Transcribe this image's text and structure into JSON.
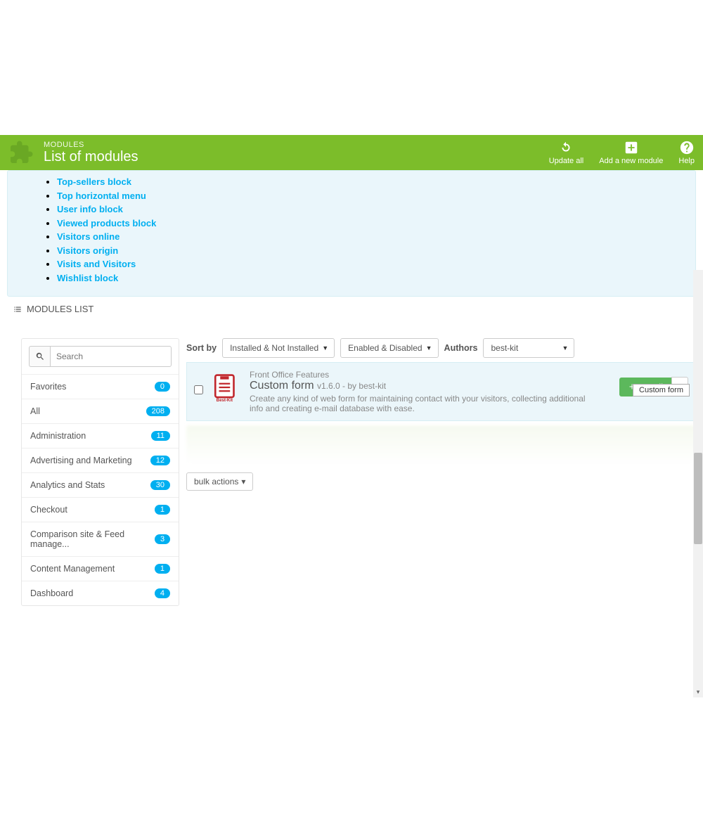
{
  "header": {
    "crumb": "MODULES",
    "title": "List of modules",
    "update": "Update all",
    "add": "Add a new module",
    "help": "Help"
  },
  "linklist": [
    "Top-sellers block",
    "Top horizontal menu",
    "User info block",
    "Viewed products block",
    "Visitors online",
    "Visitors origin",
    "Visits and Visitors",
    "Wishlist block"
  ],
  "section_title": "MODULES LIST",
  "search": {
    "placeholder": "Search"
  },
  "categories": [
    {
      "label": "Favorites",
      "count": "0"
    },
    {
      "label": "All",
      "count": "208"
    },
    {
      "label": "Administration",
      "count": "11"
    },
    {
      "label": "Advertising and Marketing",
      "count": "12"
    },
    {
      "label": "Analytics and Stats",
      "count": "30"
    },
    {
      "label": "Checkout",
      "count": "1"
    },
    {
      "label": "Comparison site & Feed manage...",
      "count": "3"
    },
    {
      "label": "Content Management",
      "count": "1"
    },
    {
      "label": "Dashboard",
      "count": "4"
    }
  ],
  "sort": {
    "label": "Sort by",
    "sel1": "Installed & Not Installed",
    "sel2": "Enabled & Disabled",
    "authors_label": "Authors",
    "sel3": "best-kit"
  },
  "module": {
    "category": "Front Office Features",
    "name": "Custom form",
    "version": "v1.6.0 - by best-kit",
    "desc": "Create any kind of web form for maintaining contact with your visitors, collecting additional info and creating e-mail database with ease.",
    "install": "Install",
    "tooltip": "Custom form"
  },
  "bulk": "bulk actions"
}
